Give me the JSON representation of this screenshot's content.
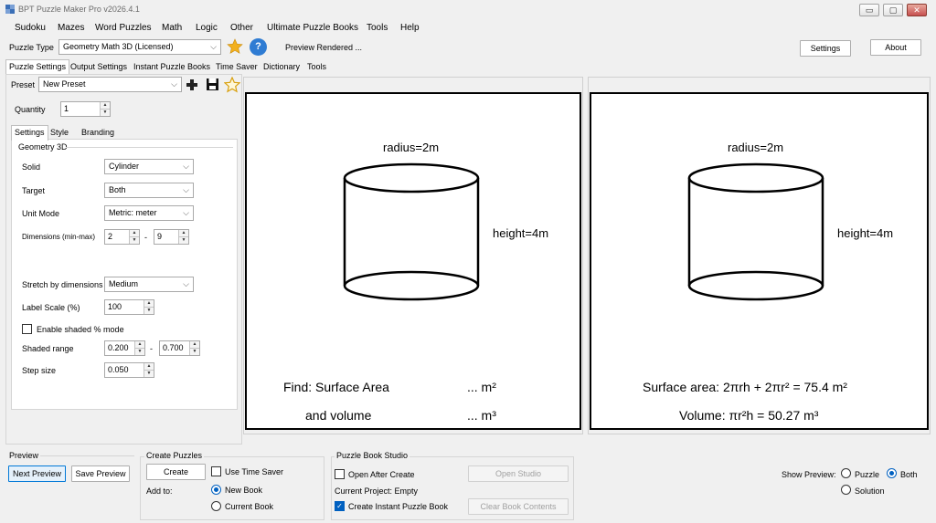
{
  "window": {
    "title": "BPT Puzzle Maker Pro v2026.4.1",
    "minimize": "▭",
    "maximize": "▢",
    "close": "✕"
  },
  "menu": [
    "Sudoku",
    "Mazes",
    "Word Puzzles",
    "Math",
    "Logic",
    "Other",
    "Ultimate Puzzle Books",
    "Tools",
    "Help"
  ],
  "toolbar": {
    "puzzle_type_label": "Puzzle Type",
    "puzzle_type_value": "Geometry Math 3D (Licensed)",
    "status": "Preview Rendered ...",
    "settings_btn": "Settings",
    "about_btn": "About"
  },
  "main_tabs": [
    "Puzzle Settings",
    "Output Settings",
    "Instant Puzzle Books",
    "Time Saver",
    "Dictionary",
    "Tools"
  ],
  "preset": {
    "label": "Preset",
    "value": "New Preset"
  },
  "quantity": {
    "label": "Quantity",
    "value": "1"
  },
  "sub_tabs": [
    "Settings",
    "Style",
    "Branding"
  ],
  "geometry": {
    "group_title": "Geometry 3D",
    "solid_label": "Solid",
    "solid_value": "Cylinder",
    "target_label": "Target",
    "target_value": "Both",
    "unit_label": "Unit Mode",
    "unit_value": "Metric: meter",
    "dims_label": "Dimensions (min-max)",
    "dims_min": "2",
    "dims_sep": "-",
    "dims_max": "9",
    "stretch_label": "Stretch by dimensions",
    "stretch_value": "Medium",
    "label_scale_label": "Label Scale (%)",
    "label_scale_value": "100",
    "shaded_label": "Enable shaded % mode",
    "shaded_range_label": "Shaded range",
    "shaded_min": "0.200",
    "shaded_sep": "-",
    "shaded_max": "0.700",
    "step_label": "Step size",
    "step_value": "0.050"
  },
  "puzzle_preview": {
    "radius": "radius=2m",
    "height": "height=4m",
    "line1_left": "Find: Surface Area",
    "line1_right": "... m²",
    "line2_left": "and volume",
    "line2_right": "... m³"
  },
  "solution_preview": {
    "radius": "radius=2m",
    "height": "height=4m",
    "line1": "Surface area: 2πrh + 2πr² = 75.4 m²",
    "line2": "Volume: πr²h = 50.27 m³"
  },
  "preview_group": {
    "title": "Preview",
    "next": "Next Preview",
    "save": "Save Preview"
  },
  "create_group": {
    "title": "Create Puzzles",
    "create": "Create",
    "use_time_saver": "Use Time Saver",
    "add_to": "Add to:",
    "new_book": "New Book",
    "current_book": "Current Book"
  },
  "studio_group": {
    "title": "Puzzle Book Studio",
    "open_after": "Open After Create",
    "open_studio": "Open Studio",
    "current_project": "Current Project: Empty",
    "create_instant": "Create Instant Puzzle Book",
    "clear_book": "Clear Book Contents"
  },
  "show_preview": {
    "label": "Show Preview:",
    "puzzle": "Puzzle",
    "both": "Both",
    "solution": "Solution"
  }
}
